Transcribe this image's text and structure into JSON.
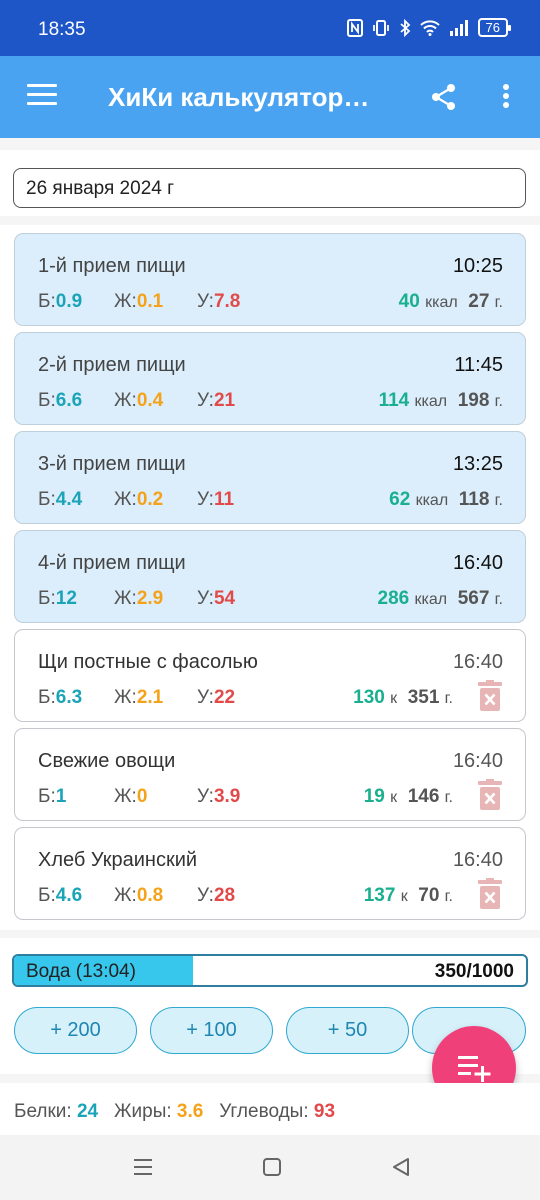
{
  "status_bar": {
    "time": "18:35",
    "battery": "76"
  },
  "app_bar": {
    "title": "ХиКи калькулятор…"
  },
  "date": {
    "value": "26 января 2024 г"
  },
  "labels": {
    "b": "Б:",
    "z": "Ж:",
    "u": "У:",
    "kcal_unit": "ккал",
    "kcal_short": "к",
    "gram_unit": "г."
  },
  "meals": [
    {
      "name": "1-й прием пищи",
      "time": "10:25",
      "b": "0.9",
      "z": "0.1",
      "u": "7.8",
      "kcal": "40",
      "grams": "27"
    },
    {
      "name": "2-й прием пищи",
      "time": "11:45",
      "b": "6.6",
      "z": "0.4",
      "u": "21",
      "kcal": "114",
      "grams": "198"
    },
    {
      "name": "3-й прием пищи",
      "time": "13:25",
      "b": "4.4",
      "z": "0.2",
      "u": "11",
      "kcal": "62",
      "grams": "118"
    },
    {
      "name": "4-й прием пищи",
      "time": "16:40",
      "b": "12",
      "z": "2.9",
      "u": "54",
      "kcal": "286",
      "grams": "567"
    }
  ],
  "foods": [
    {
      "name": "Щи постные с фасолью",
      "time": "16:40",
      "b": "6.3",
      "z": "2.1",
      "u": "22",
      "kcal": "130",
      "grams": "351"
    },
    {
      "name": "Свежие овощи",
      "time": "16:40",
      "b": "1",
      "z": "0",
      "u": "3.9",
      "kcal": "19",
      "grams": "146"
    },
    {
      "name": "Хлеб Украинский",
      "time": "16:40",
      "b": "4.6",
      "z": "0.8",
      "u": "28",
      "kcal": "137",
      "grams": "70"
    }
  ],
  "water": {
    "label": "Вода (13:04)",
    "value": "350/1000",
    "progress": 0.35,
    "buttons": [
      "+ 200",
      "+ 100",
      "+ 50"
    ]
  },
  "totals": {
    "protein_label": "Белки:",
    "protein": "24",
    "fat_label": "Жиры:",
    "fat": "3.6",
    "carbs_label": "Углеводы:",
    "carbs": "93"
  },
  "colors": {
    "status_bar": "#1e56c7",
    "app_bar": "#4aa3f0",
    "fab": "#f0407a",
    "protein": "#1ba4b8",
    "fat": "#f5a21b",
    "carbs": "#e24a4a",
    "kcal": "#1aaf8e"
  },
  "icons": [
    "menu-icon",
    "share-icon",
    "more-vert-icon",
    "trash-icon",
    "playlist-add-icon",
    "recents-icon",
    "home-icon",
    "back-icon"
  ]
}
